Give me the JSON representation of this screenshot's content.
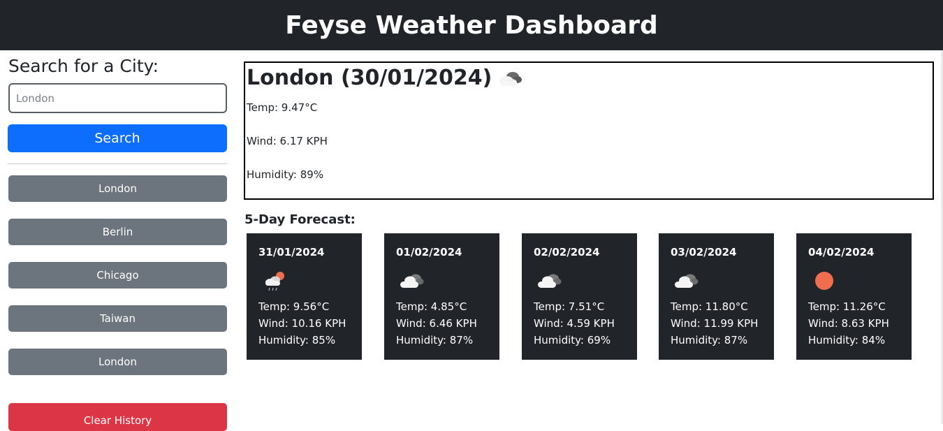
{
  "header": {
    "title": "Feyse Weather Dashboard"
  },
  "search": {
    "title": "Search for a City:",
    "placeholder": "London",
    "button_label": "Search"
  },
  "history": [
    "London",
    "Berlin",
    "Chicago",
    "Taiwan",
    "London"
  ],
  "clear_label": "Clear History",
  "current": {
    "title": "London (30/01/2024)",
    "icon": "cloud-icon",
    "temp": "Temp: 9.47°C",
    "wind": "Wind: 6.17 KPH",
    "humidity": "Humidity: 89%"
  },
  "forecast": {
    "title": "5-Day Forecast:",
    "days": [
      {
        "date": "31/01/2024",
        "icon": "rain-sun-icon",
        "temp": "Temp: 9.56°C",
        "wind": "Wind: 10.16 KPH",
        "humidity": "Humidity: 85%"
      },
      {
        "date": "01/02/2024",
        "icon": "cloud-icon",
        "temp": "Temp: 4.85°C",
        "wind": "Wind: 6.46 KPH",
        "humidity": "Humidity: 87%"
      },
      {
        "date": "02/02/2024",
        "icon": "cloud-icon",
        "temp": "Temp: 7.51°C",
        "wind": "Wind: 4.59 KPH",
        "humidity": "Humidity: 69%"
      },
      {
        "date": "03/02/2024",
        "icon": "cloud-icon",
        "temp": "Temp: 11.80°C",
        "wind": "Wind: 11.99 KPH",
        "humidity": "Humidity: 87%"
      },
      {
        "date": "04/02/2024",
        "icon": "sun-icon",
        "temp": "Temp: 11.26°C",
        "wind": "Wind: 8.63 KPH",
        "humidity": "Humidity: 84%"
      }
    ]
  },
  "colors": {
    "header_bg": "#212529",
    "primary": "#0d6efd",
    "secondary": "#6c757d",
    "danger": "#dc3545",
    "sun": "#ee6e4f"
  }
}
